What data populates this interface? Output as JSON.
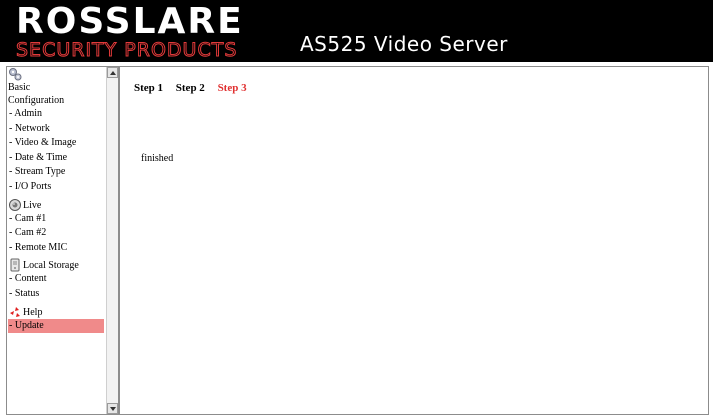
{
  "header": {
    "brand_name": "ROSSLARE",
    "brand_tagline": "SECURITY PRODUCTS",
    "product_title": "AS525 Video Server"
  },
  "sidebar": {
    "sections": [
      {
        "title": "Basic Configuration",
        "icon": "gears-icon",
        "items": [
          "- Admin",
          "- Network",
          "- Video & Image",
          "- Date & Time",
          "- Stream Type",
          "- I/O Ports"
        ]
      },
      {
        "title": "Live",
        "icon": "camera-icon",
        "items": [
          "- Cam #1",
          "- Cam #2",
          "- Remote MIC"
        ]
      },
      {
        "title": "Local Storage",
        "icon": "storage-icon",
        "items": [
          "- Content",
          "- Status"
        ]
      },
      {
        "title": "Help",
        "icon": "help-icon",
        "items": [
          "- Update"
        ]
      }
    ],
    "active_item": "- Update"
  },
  "main": {
    "steps": [
      "Step 1",
      "Step 2",
      "Step 3"
    ],
    "current_step": "Step 3",
    "status_text": "finished"
  },
  "colors": {
    "header_bg": "#000000",
    "brand_red": "#e23a3a",
    "active_highlight": "#f08a8a",
    "current_step": "#e03030"
  }
}
